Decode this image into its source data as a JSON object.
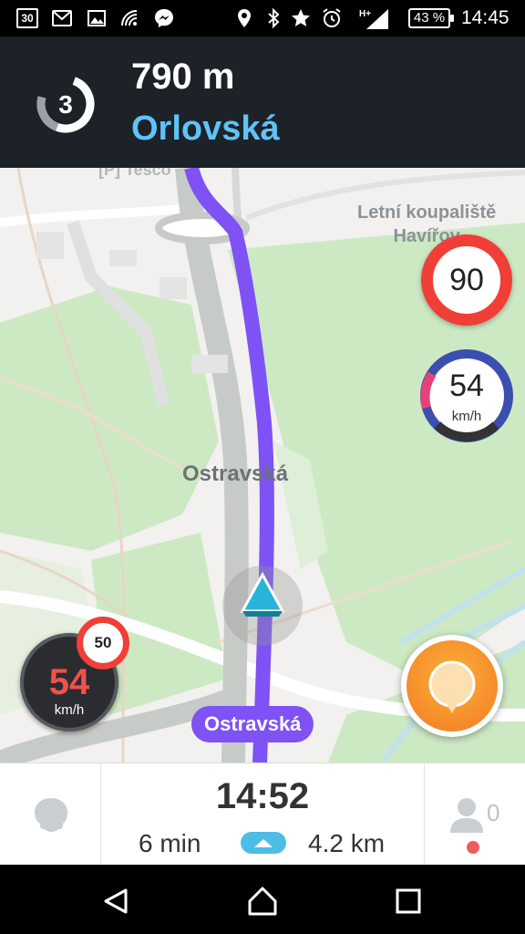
{
  "status_bar": {
    "calendar_day": "30",
    "battery": "43 %",
    "time": "14:45",
    "icons": [
      "calendar-icon",
      "gmail-icon",
      "gallery-icon",
      "wifi-signal-icon",
      "messenger-icon",
      "location-icon",
      "bluetooth-icon",
      "star-icon",
      "alarm-icon",
      "mobile-signal-icon",
      "battery-icon"
    ]
  },
  "navigation": {
    "next_turn_exit": "3",
    "distance": "790 m",
    "street": "Orlovská"
  },
  "map": {
    "poi_label": "[P] Tesco",
    "pool_label_line1": "Letní koupaliště",
    "pool_label_line2": "Havířov",
    "road_label": "Ostravská",
    "current_road": "Ostravská",
    "speed_limit": "90",
    "speed_value": "54",
    "speed_unit": "km/h",
    "small_speed_limit": "50",
    "small_speed_value": "54",
    "small_speed_unit": "km/h",
    "route_color": "#7e52f4"
  },
  "trip": {
    "eta": "14:52",
    "duration": "6 min",
    "distance": "4.2 km",
    "users_online": "0"
  }
}
